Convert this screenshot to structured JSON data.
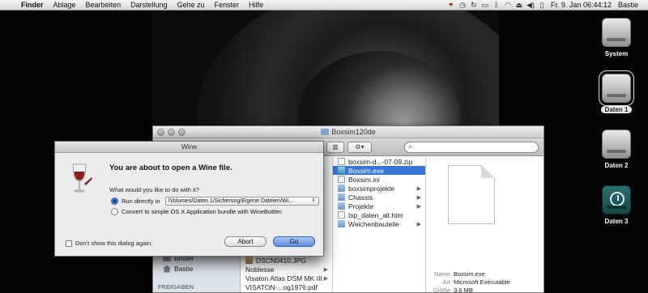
{
  "menubar": {
    "app_name": "Finder",
    "menus": [
      "Ablage",
      "Bearbeiten",
      "Darstellung",
      "Gehe zu",
      "Fenster",
      "Hilfe"
    ],
    "clock": "Fr. 9. Jan  06:44:12",
    "user": "Bastie"
  },
  "desktop": {
    "icons": [
      {
        "label": "System",
        "icon": "hard-drive-icon"
      },
      {
        "label": "Daten 1",
        "icon": "hard-drive-icon",
        "selected": true
      },
      {
        "label": "Daten 2",
        "icon": "hard-drive-icon"
      },
      {
        "label": "Daten 3",
        "icon": "time-machine-drive-icon"
      }
    ]
  },
  "finder": {
    "title": "Boxsim120de",
    "sidebar": {
      "items": [
        "Binder",
        "Bastie"
      ],
      "section": "FREIGABEN"
    },
    "column1": [
      "DSCN0410.JPG",
      "Noblesse",
      "Visaton Atlas DSM MK III",
      "VISATON-...og1976.pdf"
    ],
    "column2": [
      {
        "label": "boxsim-d...-07-09.zip",
        "type": "doc",
        "folder": false
      },
      {
        "label": "Boxsim.exe",
        "type": "exe",
        "folder": false,
        "selected": true
      },
      {
        "label": "Boxsim.ini",
        "type": "ini",
        "folder": false
      },
      {
        "label": "boxsimprojekte",
        "type": "folder",
        "folder": true
      },
      {
        "label": "Chassis",
        "type": "folder",
        "folder": true
      },
      {
        "label": "Projekte",
        "type": "folder",
        "folder": true
      },
      {
        "label": "tsp_daten_alt.htm",
        "type": "doc",
        "folder": false
      },
      {
        "label": "Weichenbauteile",
        "type": "folder",
        "folder": true
      }
    ],
    "preview_meta": {
      "name_key": "Name",
      "name_value": "Boxsim.exe",
      "kind_key": "Art",
      "kind_value": "Microsoft Executable",
      "size_key": "Größe",
      "size_value": "3,6 MB"
    }
  },
  "wine_dialog": {
    "title": "Wine",
    "heading": "You are about to open a Wine file.",
    "question": "What would you like to do with it?",
    "option_run_label": "Run directly in",
    "option_run_path": "/Volumes/Daten 1/Sicherung/Eigene Dateien/Wi...",
    "option_convert_label": "Convert to simple OS X Application bundle with WineBottler.",
    "dont_show_label": "Don't show this dialog again.",
    "abort_label": "Abort",
    "go_label": "Go"
  }
}
